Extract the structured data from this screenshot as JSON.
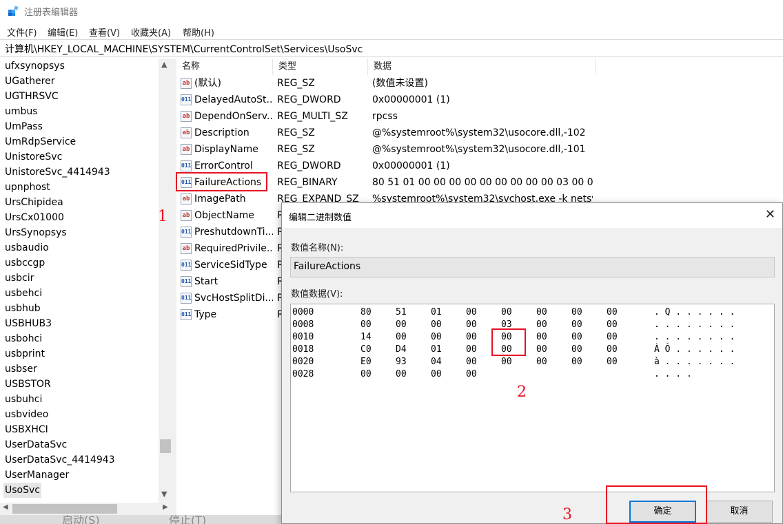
{
  "window": {
    "title": "注册表编辑器"
  },
  "menu": [
    "文件(F)",
    "编辑(E)",
    "查看(V)",
    "收藏夹(A)",
    "帮助(H)"
  ],
  "address": "计算机\\HKEY_LOCAL_MACHINE\\SYSTEM\\CurrentControlSet\\Services\\UsoSvc",
  "tree": {
    "items": [
      "ufxsynopsys",
      "UGatherer",
      "UGTHRSVC",
      "umbus",
      "UmPass",
      "UmRdpService",
      "UnistoreSvc",
      "UnistoreSvc_4414943",
      "upnphost",
      "UrsChipidea",
      "UrsCx01000",
      "UrsSynopsys",
      "usbaudio",
      "usbccgp",
      "usbcir",
      "usbehci",
      "usbhub",
      "USBHUB3",
      "usbohci",
      "usbprint",
      "usbser",
      "USBSTOR",
      "usbuhci",
      "usbvideo",
      "USBXHCI",
      "UserDataSvc",
      "UserDataSvc_4414943",
      "UserManager",
      "UsoSvc"
    ],
    "selected": "UsoSvc"
  },
  "list": {
    "headers": {
      "name": "名称",
      "type": "类型",
      "data": "数据"
    },
    "rows": [
      {
        "icon": "string-value-icon",
        "glyph": "ab",
        "name": "(默认)",
        "type": "REG_SZ",
        "data": "(数值未设置)"
      },
      {
        "icon": "binary-value-icon",
        "glyph": "011",
        "name": "DelayedAutoSt...",
        "type": "REG_DWORD",
        "data": "0x00000001 (1)"
      },
      {
        "icon": "string-value-icon",
        "glyph": "ab",
        "name": "DependOnServ...",
        "type": "REG_MULTI_SZ",
        "data": "rpcss"
      },
      {
        "icon": "string-value-icon",
        "glyph": "ab",
        "name": "Description",
        "type": "REG_SZ",
        "data": "@%systemroot%\\system32\\usocore.dll,-102"
      },
      {
        "icon": "string-value-icon",
        "glyph": "ab",
        "name": "DisplayName",
        "type": "REG_SZ",
        "data": "@%systemroot%\\system32\\usocore.dll,-101"
      },
      {
        "icon": "binary-value-icon",
        "glyph": "011",
        "name": "ErrorControl",
        "type": "REG_DWORD",
        "data": "0x00000001 (1)"
      },
      {
        "icon": "binary-value-icon",
        "glyph": "011",
        "name": "FailureActions",
        "type": "REG_BINARY",
        "data": "80 51 01 00 00 00 00 00 00 00 00 00 03 00 00 0..."
      },
      {
        "icon": "string-value-icon",
        "glyph": "ab",
        "name": "ImagePath",
        "type": "REG_EXPAND_SZ",
        "data": "%systemroot%\\system32\\svchost.exe -k netsvc..."
      },
      {
        "icon": "string-value-icon",
        "glyph": "ab",
        "name": "ObjectName",
        "type": "R",
        "data": ""
      },
      {
        "icon": "binary-value-icon",
        "glyph": "011",
        "name": "PreshutdownTi...",
        "type": "R",
        "data": ""
      },
      {
        "icon": "string-value-icon",
        "glyph": "ab",
        "name": "RequiredPrivile...",
        "type": "R",
        "data": ""
      },
      {
        "icon": "binary-value-icon",
        "glyph": "011",
        "name": "ServiceSidType",
        "type": "R",
        "data": ""
      },
      {
        "icon": "binary-value-icon",
        "glyph": "011",
        "name": "Start",
        "type": "R",
        "data": ""
      },
      {
        "icon": "binary-value-icon",
        "glyph": "011",
        "name": "SvcHostSplitDi...",
        "type": "R",
        "data": ""
      },
      {
        "icon": "binary-value-icon",
        "glyph": "011",
        "name": "Type",
        "type": "R",
        "data": ""
      }
    ]
  },
  "annotations": {
    "n1": "1",
    "n2": "2",
    "n3": "3"
  },
  "dialog": {
    "title": "编辑二进制数值",
    "close": "✕",
    "name_label": "数值名称(N):",
    "name_value": "FailureActions",
    "data_label": "数值数据(V):",
    "hex": [
      {
        "addr": "0000",
        "bytes": [
          "80",
          "51",
          "01",
          "00",
          "00",
          "00",
          "00",
          "00"
        ],
        "ascii": ". Q . . . . . ."
      },
      {
        "addr": "0008",
        "bytes": [
          "00",
          "00",
          "00",
          "00",
          "03",
          "00",
          "00",
          "00"
        ],
        "ascii": ". . . . . . . ."
      },
      {
        "addr": "0010",
        "bytes": [
          "14",
          "00",
          "00",
          "00",
          "00",
          "00",
          "00",
          "00"
        ],
        "ascii": ". . . . . . . ."
      },
      {
        "addr": "0018",
        "bytes": [
          "C0",
          "D4",
          "01",
          "00",
          "00",
          "00",
          "00",
          "00"
        ],
        "ascii": "À Ô . . . . . ."
      },
      {
        "addr": "0020",
        "bytes": [
          "E0",
          "93",
          "04",
          "00",
          "00",
          "00",
          "00",
          "00"
        ],
        "ascii": "à . . . . . . ."
      },
      {
        "addr": "0028",
        "bytes": [
          "00",
          "00",
          "00",
          "00"
        ],
        "ascii": ". . . ."
      }
    ],
    "ok": "确定",
    "cancel": "取消"
  },
  "background_buttons": [
    "启动(S)",
    "停止(T)"
  ]
}
